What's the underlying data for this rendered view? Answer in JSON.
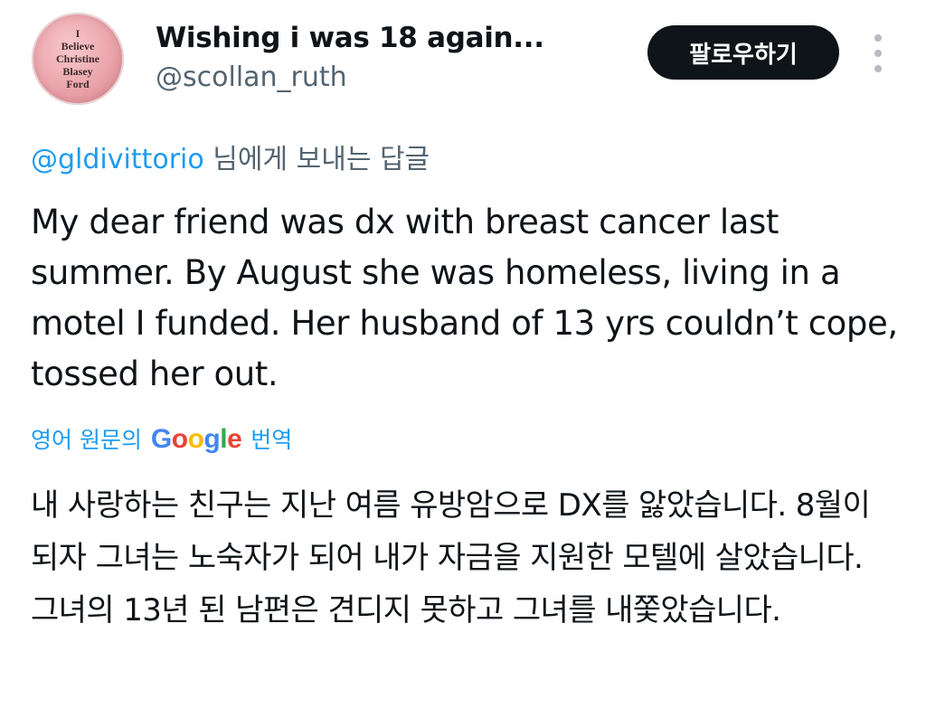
{
  "user": {
    "avatar_text": [
      "I",
      "Believe",
      "Christine",
      "Blasey",
      "Ford"
    ],
    "display_name": "Wishing i was 18 again...",
    "handle": "@scollan_ruth"
  },
  "actions": {
    "follow_label": "팔로우하기",
    "more_icon": "more-vertical-icon"
  },
  "reply": {
    "mention": "@gldivittorio",
    "suffix": " 님에게 보내는 답글"
  },
  "tweet": {
    "text": "My dear friend was dx with breast cancer last summer. By August she was homeless, living in a motel I funded. Her husband of 13 yrs couldn’t cope, tossed her out."
  },
  "translation": {
    "prefix": "영어 원문의 ",
    "brand_letters": [
      {
        "char": "G",
        "color": "#4285F4"
      },
      {
        "char": "o",
        "color": "#EA4335"
      },
      {
        "char": "o",
        "color": "#FBBC05"
      },
      {
        "char": "g",
        "color": "#4285F4"
      },
      {
        "char": "l",
        "color": "#34A853"
      },
      {
        "char": "e",
        "color": "#EA4335"
      }
    ],
    "suffix": " 번역",
    "text": "내 사랑하는 친구는 지난 여름 유방암으로 DX를 앓았습니다. 8월이 되자 그녀는 노숙자가 되어 내가 자금을 지원한 모텔에 살았습니다. 그녀의 13년 된 남편은 견디지 못하고 그녀를 내쫓았습니다."
  },
  "colors": {
    "text_primary": "#0f1419",
    "text_secondary": "#536471",
    "accent": "#1d9bf0",
    "button_bg": "#0f1419"
  }
}
